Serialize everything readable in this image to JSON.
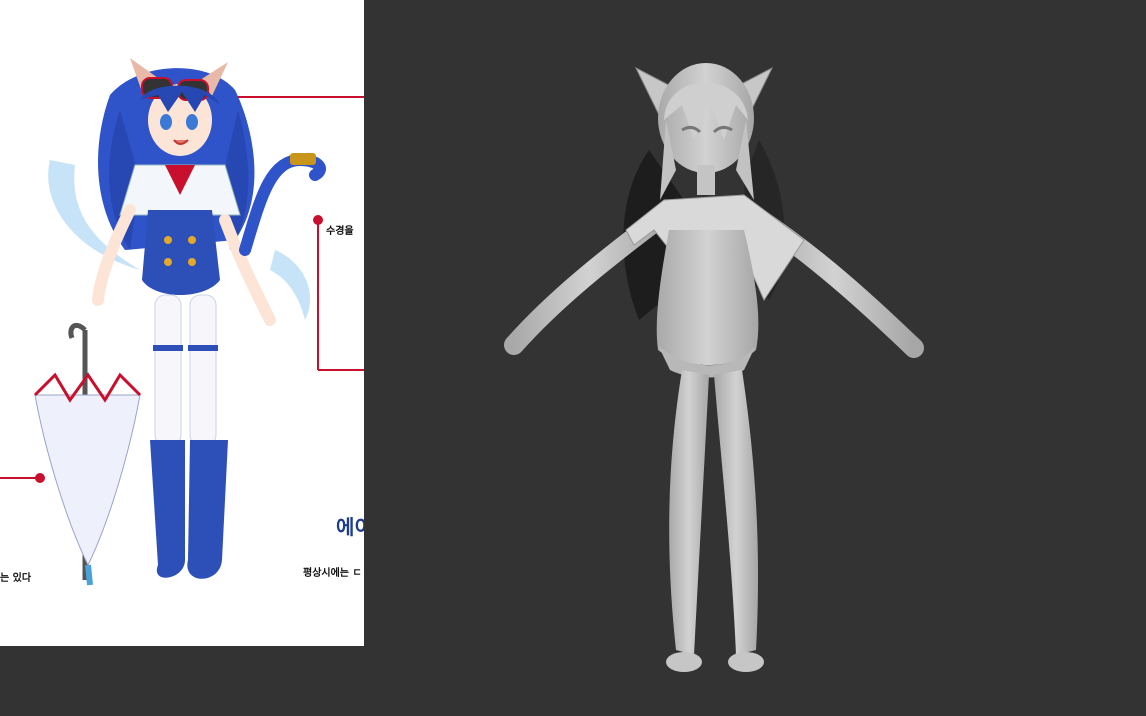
{
  "reference_sheet": {
    "annotation_water": "수경을 ",
    "heading_partial": "에이",
    "caption_normal": "평상시에는 ㄷ",
    "caption_left": "는 있다"
  },
  "colors": {
    "viewport_bg": "#333333",
    "reference_bg": "#ffffff",
    "callout_red": "#c8102e",
    "hair_blue": "#2f54c9",
    "model_grey": "#bdbdbd"
  },
  "icons": [
    "goggles-icon",
    "umbrella-icon",
    "cat-tail-icon"
  ]
}
